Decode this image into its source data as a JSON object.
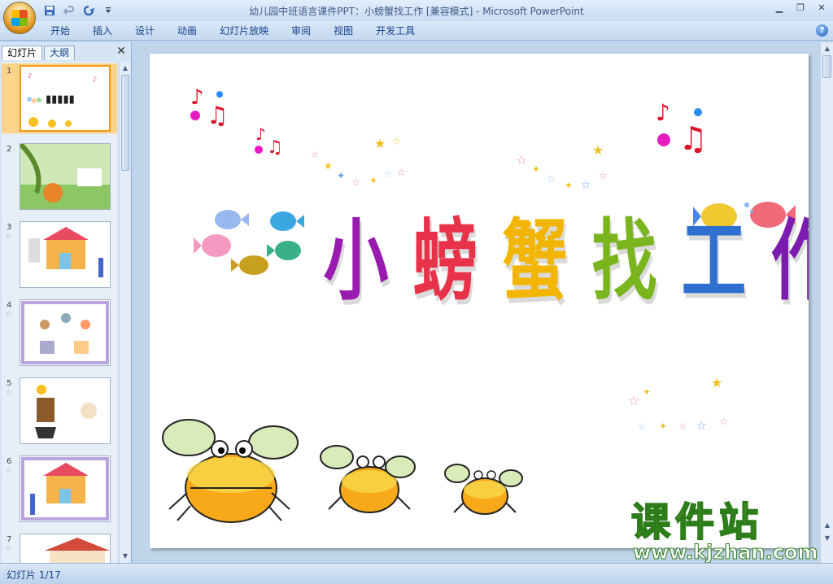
{
  "titlebar": {
    "title": "幼儿园中班语言课件PPT：小螃蟹找工作 [兼容模式] - Microsoft PowerPoint",
    "title_color": "#3e5a86"
  },
  "ribbon": {
    "tabs": [
      "开始",
      "插入",
      "设计",
      "动画",
      "幻灯片放映",
      "审阅",
      "视图",
      "开发工具"
    ],
    "help_label": "?"
  },
  "panel": {
    "tab_slides": "幻灯片",
    "tab_outline": "大纲",
    "close_glyph": "✕",
    "thumbnails": [
      {
        "num": "1",
        "selected": true
      },
      {
        "num": "2"
      },
      {
        "num": "3"
      },
      {
        "num": "4"
      },
      {
        "num": "5"
      },
      {
        "num": "6"
      },
      {
        "num": "7"
      }
    ],
    "star_glyph": "☆"
  },
  "slide": {
    "title_chars": [
      "小",
      "螃",
      "蟹",
      "找",
      "工",
      "作"
    ],
    "title_colors": [
      "#9a1bb0",
      "#e8324a",
      "#f2b600",
      "#7ab51d",
      "#2f6fd0",
      "#7b1bb0"
    ]
  },
  "statusbar": {
    "slide_counter": "幻灯片 1/17"
  },
  "watermark": {
    "big": "课件站",
    "small": "www.kjzhan.com"
  },
  "icons": {
    "office": "office-button-icon",
    "save": "save-icon",
    "undo": "undo-icon",
    "redo": "redo-icon",
    "customize": "customize-qat-icon"
  }
}
